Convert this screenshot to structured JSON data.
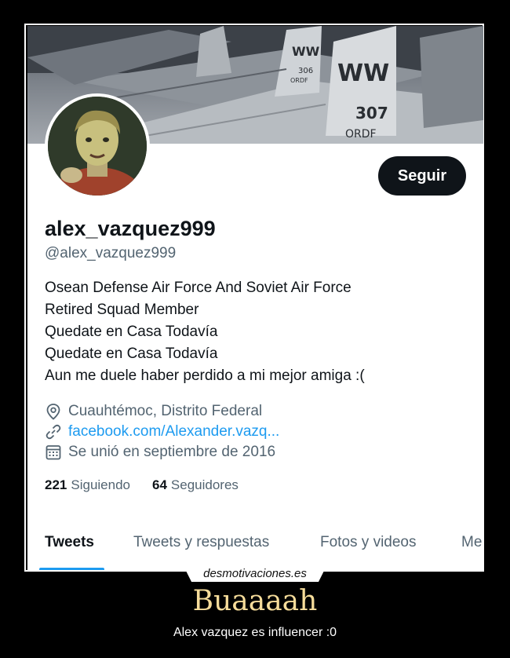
{
  "profile": {
    "follow_label": "Seguir",
    "display_name": "alex_vazquez999",
    "handle": "@alex_vazquez999",
    "bio": [
      "Osean Defense Air Force And Soviet Air Force",
      "Retired Squad Member",
      "Quedate en Casa Todavía",
      "Quedate en Casa Todavía",
      "Aun me duele haber perdido a mi mejor amiga :("
    ],
    "location": "Cuauhtémoc, Distrito Federal",
    "website": "facebook.com/Alexander.vazq...",
    "joined": "Se unió en septiembre de 2016",
    "following_count": "221",
    "following_label": "Siguiendo",
    "followers_count": "64",
    "followers_label": "Seguidores",
    "banner_text": {
      "tail_1": "WW",
      "tail_1_num": "306",
      "tail_1_small": "ORDF",
      "tail_2": "WW",
      "tail_2_num": "307",
      "tail_2_small": "ORDF"
    }
  },
  "tabs": [
    {
      "label": "Tweets",
      "active": true
    },
    {
      "label": "Tweets y respuestas",
      "active": false
    },
    {
      "label": "Fotos y videos",
      "active": false
    },
    {
      "label": "Me",
      "active": false
    }
  ],
  "site": {
    "watermark": "desmotivaciones.es"
  },
  "caption": {
    "title": "Buaaaah",
    "subtitle": "Alex vazquez es influencer :0"
  },
  "colors": {
    "background": "#000000",
    "accent": "#1d9bf0",
    "title": "#f6dc9a",
    "button": "#0f1419"
  },
  "icons": {
    "location": "location-pin-icon",
    "website": "link-icon",
    "joined": "calendar-icon"
  }
}
